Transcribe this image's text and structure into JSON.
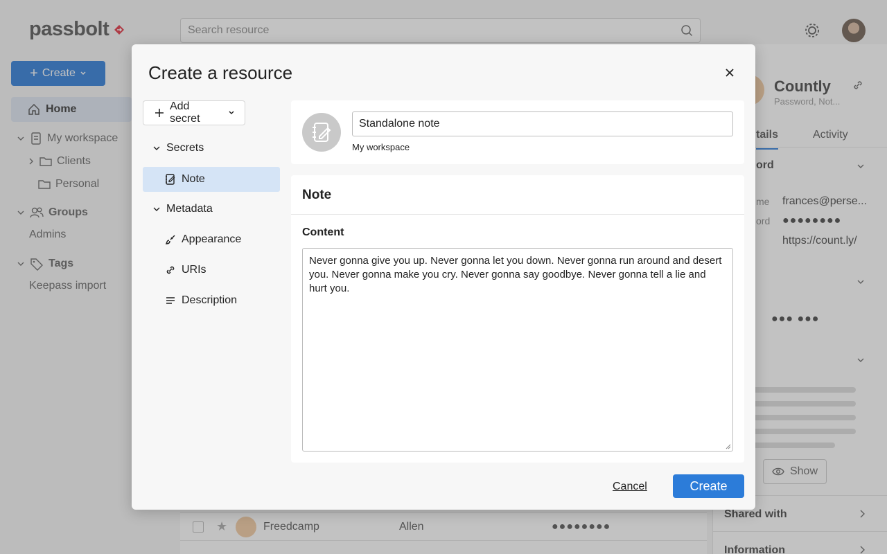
{
  "app": {
    "logo_text": "passbolt",
    "search_placeholder": "Search resource",
    "create_label": "Create",
    "nav": {
      "home": "Home",
      "my_workspace": "My workspace",
      "clients": "Clients",
      "personal": "Personal",
      "groups": "Groups",
      "admins": "Admins",
      "tags": "Tags",
      "keepass_import": "Keepass import"
    },
    "details": {
      "title": "Countly",
      "subtitle": "Password, Not...",
      "tab_details": "tails",
      "tab_activity": "Activity",
      "section_password": "ord",
      "label_username": "me",
      "label_password": "ord",
      "username": "frances@perse...",
      "password_mask": "●●●●●●●●",
      "uri": "https://count.ly/",
      "totp_mask": "●●● ●●●",
      "show_label": "Show",
      "shared_with": "Shared with",
      "information": "Information"
    },
    "grid_rows": [
      {
        "name": "Freedcamp",
        "username": "Allen",
        "password": "●●●●●●●●"
      }
    ]
  },
  "dialog": {
    "title": "Create a resource",
    "add_secret_label": "Add secret",
    "sidebar": {
      "secrets_label": "Secrets",
      "note_label": "Note",
      "metadata_label": "Metadata",
      "appearance_label": "Appearance",
      "uris_label": "URIs",
      "description_label": "Description"
    },
    "resource_name": "Standalone note",
    "folder": "My workspace",
    "note_section_title": "Note",
    "content_label": "Content",
    "content_value": "Never gonna give you up. Never gonna let you down. Never gonna run around and desert you. Never gonna make you cry. Never gonna say goodbye. Never gonna tell a lie and hurt you.",
    "cancel_label": "Cancel",
    "create_label": "Create"
  },
  "colors": {
    "primary": "#2c7cd9",
    "selected_bg": "#d5e4f6",
    "logo_accent": "#e1313f"
  }
}
